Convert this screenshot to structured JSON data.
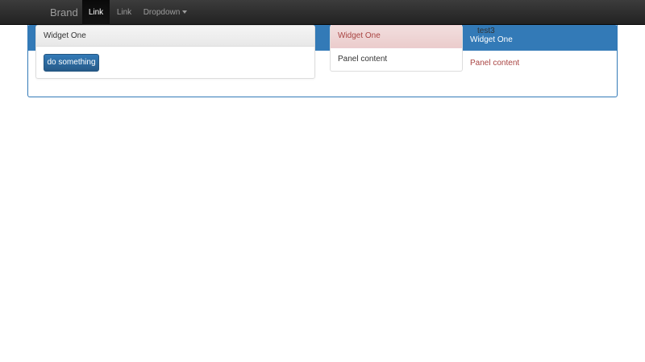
{
  "navbar": {
    "brand": "Brand",
    "links": [
      {
        "label": "Link",
        "active": true
      },
      {
        "label": "Link",
        "active": false
      }
    ],
    "dropdown_label": "Dropdown"
  },
  "widgets": {
    "one": {
      "title": "Widget One",
      "button_label": "do something"
    },
    "danger": {
      "title": "Widget One",
      "body": "Panel content"
    },
    "primary": {
      "label_above": "test3",
      "title": "Widget One",
      "body": "Panel content"
    }
  },
  "colors": {
    "navbar_bg": "#222222",
    "primary": "#337ab7",
    "danger_text": "#a94442",
    "danger_bg": "#f2dede"
  }
}
